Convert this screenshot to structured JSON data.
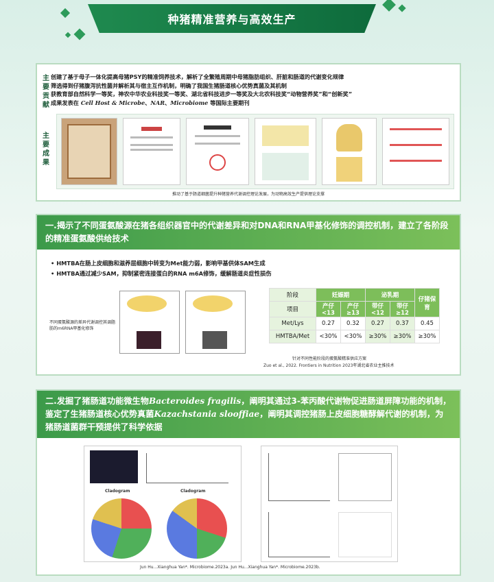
{
  "title": "种猪精准营养与高效生产",
  "section1": {
    "label_contrib": [
      "主",
      "要",
      "贡",
      "献"
    ],
    "label_results": [
      "主",
      "要",
      "成",
      "果"
    ],
    "lines": [
      "创建了基于母子一体化提高母猪PSY的精准饲养技术，解析了全繁殖周期中母猪脂肪组织、肝脏和肠道的代谢变化规律",
      "筛选得到仔猪腹泻抗性菌并解析其与宿主互作机制，明确了我国生猪肠道核心优势真菌及其机制",
      "获教育部自然科学一等奖，神农中华农业科技奖一等奖、湖北省科技进步一等奖及大北农科技奖“动物营养奖”和“创新奖”"
    ],
    "line4_pre": "成果发表在",
    "journal1": "Cell Host & Microbe",
    "journal2": "NAR",
    "journal3": "Microbiome",
    "line4_post": "等国际主要期刊",
    "caption": "推动了基于肠道细菌提升种猪营养代谢调控理论发展，为动物高效生产提供理论支撑"
  },
  "section2": {
    "heading": "一.揭示了不同蛋氨酸源在猪各组织器官中的代谢差异和对DNA和RNA甲基化修饰的调控机制，建立了各阶段的精准蛋氨酸供给技术",
    "bullet1": "HMTBA在肠上皮细胞和滋养层细胞中转变为Met能力弱，影响甲基供体SAM生成",
    "bullet2": "HMTBA通过减少SAM，抑制紧密连接蛋白的RNA m6A修饰，缓解肠道炎症性损伤",
    "diagram_caption": "不同蛋氨酸源的差异代谢调控其调脂肪的m6RNA甲基化修饰",
    "table": {
      "stage_label": "阶段",
      "item_label": "项目",
      "preg": "妊娠期",
      "lact": "泌乳期",
      "piglet": "仔猪保育",
      "sub": [
        "产仔<13",
        "产仔≥13",
        "带仔<12",
        "带仔≥12"
      ],
      "rows": [
        {
          "name": "Met/Lys",
          "vals": [
            "0.27",
            "0.32",
            "0.27",
            "0.37",
            "0.45"
          ]
        },
        {
          "name": "HMTBA/Met",
          "vals": [
            "<30%",
            "<30%",
            "≥30%",
            "≥30%",
            "≥30%"
          ]
        }
      ]
    },
    "table_caption": "针对不同性能阶段的蛋氨酸精准供应方案",
    "citation": "Zuo et al., 2022. Frontiers in Nutrition 2023年湖北省农业主推技术"
  },
  "section3": {
    "heading_a": "二.发掘了猪肠道功能微生物",
    "species1": "Bacteroides fragilis",
    "heading_b": "，阐明其通过3-苯丙酸代谢物促进肠道屏障功能的机制，鉴定了生猪肠道核心优势真菌",
    "species2": "Kazachstania slooffiae",
    "heading_c": "，阐明其调控猪肠上皮细胞糖酵解代谢的机制，为猪肠道菌群干预提供了科学依据",
    "fig_label": "Cladogram",
    "citation": "Jun Hu...Xianghua Yan*. Microbiome.2023a.    Jun Hu...Xianghua Yan*. Microbiome.2023b."
  },
  "colors": {
    "accent": "#1f8a4f",
    "bar": "#5aad4e"
  }
}
